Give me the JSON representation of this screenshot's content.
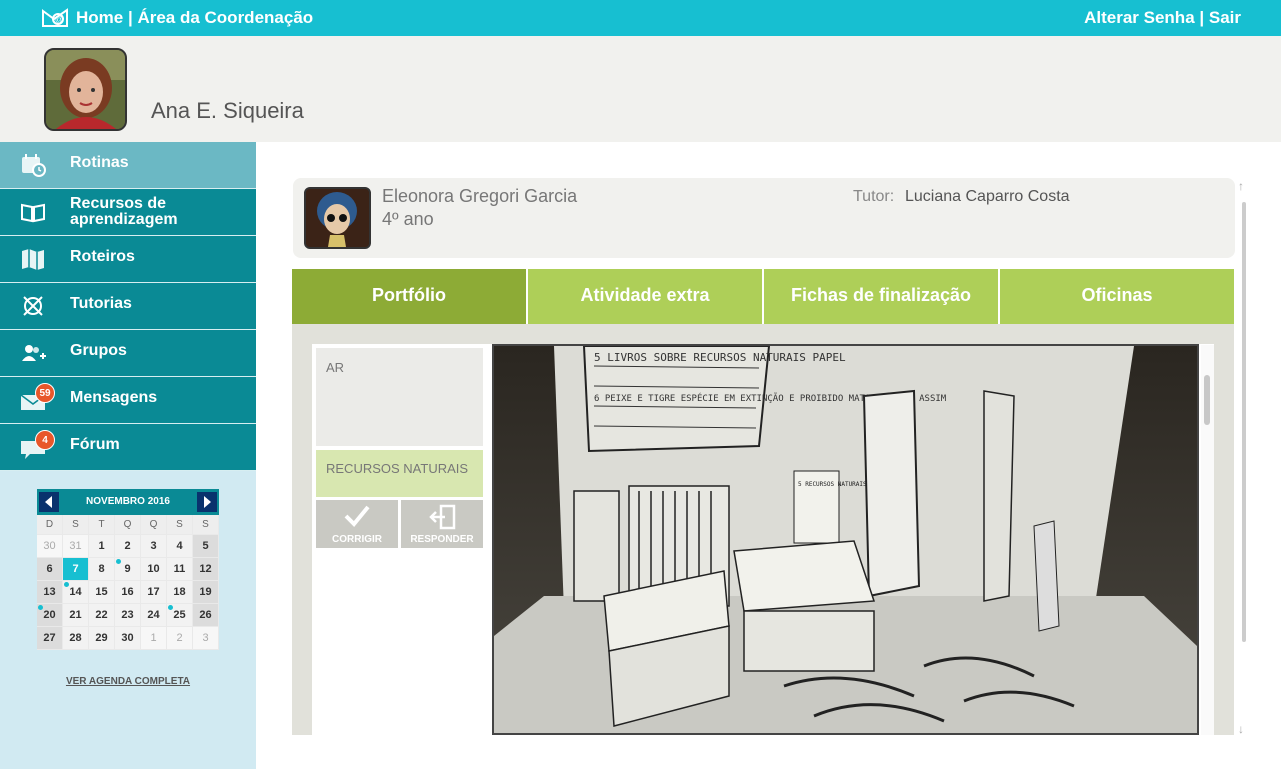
{
  "topbar": {
    "home": "Home",
    "separator": " | ",
    "area": "Área da Coordenação",
    "change_password": "Alterar Senha",
    "logout": "Sair",
    "logo_icon": "envelope-logo-icon"
  },
  "user": {
    "name": "Ana E. Siqueira"
  },
  "sidebar": {
    "items": [
      {
        "label": "Rotinas",
        "icon": "calendar-clock-icon",
        "active": true
      },
      {
        "label": "Recursos de aprendizagem",
        "icon": "book-icon"
      },
      {
        "label": "Roteiros",
        "icon": "map-icon"
      },
      {
        "label": "Tutorias",
        "icon": "compass-icon"
      },
      {
        "label": "Grupos",
        "icon": "group-icon"
      },
      {
        "label": "Mensagens",
        "icon": "mail-icon",
        "badge": "59"
      },
      {
        "label": "Fórum",
        "icon": "chat-bubble-icon",
        "badge": "4"
      }
    ]
  },
  "calendar": {
    "month": "NOVEMBRO 2016",
    "weekdays": [
      "D",
      "S",
      "T",
      "Q",
      "Q",
      "S",
      "S"
    ],
    "weeks": [
      [
        "30",
        "31",
        "1",
        "2",
        "3",
        "4",
        "5"
      ],
      [
        "6",
        "7",
        "8",
        "9",
        "10",
        "11",
        "12"
      ],
      [
        "13",
        "14",
        "15",
        "16",
        "17",
        "18",
        "19"
      ],
      [
        "20",
        "21",
        "22",
        "23",
        "24",
        "25",
        "26"
      ],
      [
        "27",
        "28",
        "29",
        "30",
        "1",
        "2",
        "3"
      ]
    ],
    "today": "7",
    "link": "VER AGENDA COMPLETA"
  },
  "student": {
    "name": "Eleonora Gregori Garcia",
    "grade": "4º ano",
    "tutor_label": "Tutor:",
    "tutor_name": "Luciana Caparro Costa"
  },
  "tabs": [
    {
      "label": "Portfólio",
      "active": true
    },
    {
      "label": "Atividade extra"
    },
    {
      "label": "Fichas de finalização"
    },
    {
      "label": "Oficinas"
    }
  ],
  "portfolio": {
    "subject": "AR",
    "resource": "RECURSOS NATURAIS",
    "correct_button": "CORRIGIR",
    "reply_button": "RESPONDER",
    "photo_labels": [
      "5 LIVROS SOBRE RECURSOS NATURAIS PAPEL",
      "6 PEIXE E TIGRE ESPÉCIE EM EXTINÇÃO E PROIBIDO MATAR BICHOS ASSIM",
      "5 RECURSOS NATURAIS"
    ]
  },
  "colors": {
    "topbar": "#17bfd1",
    "sidebar": "#0a8a95",
    "sidebar_active": "#6bb8c4",
    "tab": "#aecf58",
    "tab_active": "#8dab36",
    "badge": "#e8572a"
  }
}
